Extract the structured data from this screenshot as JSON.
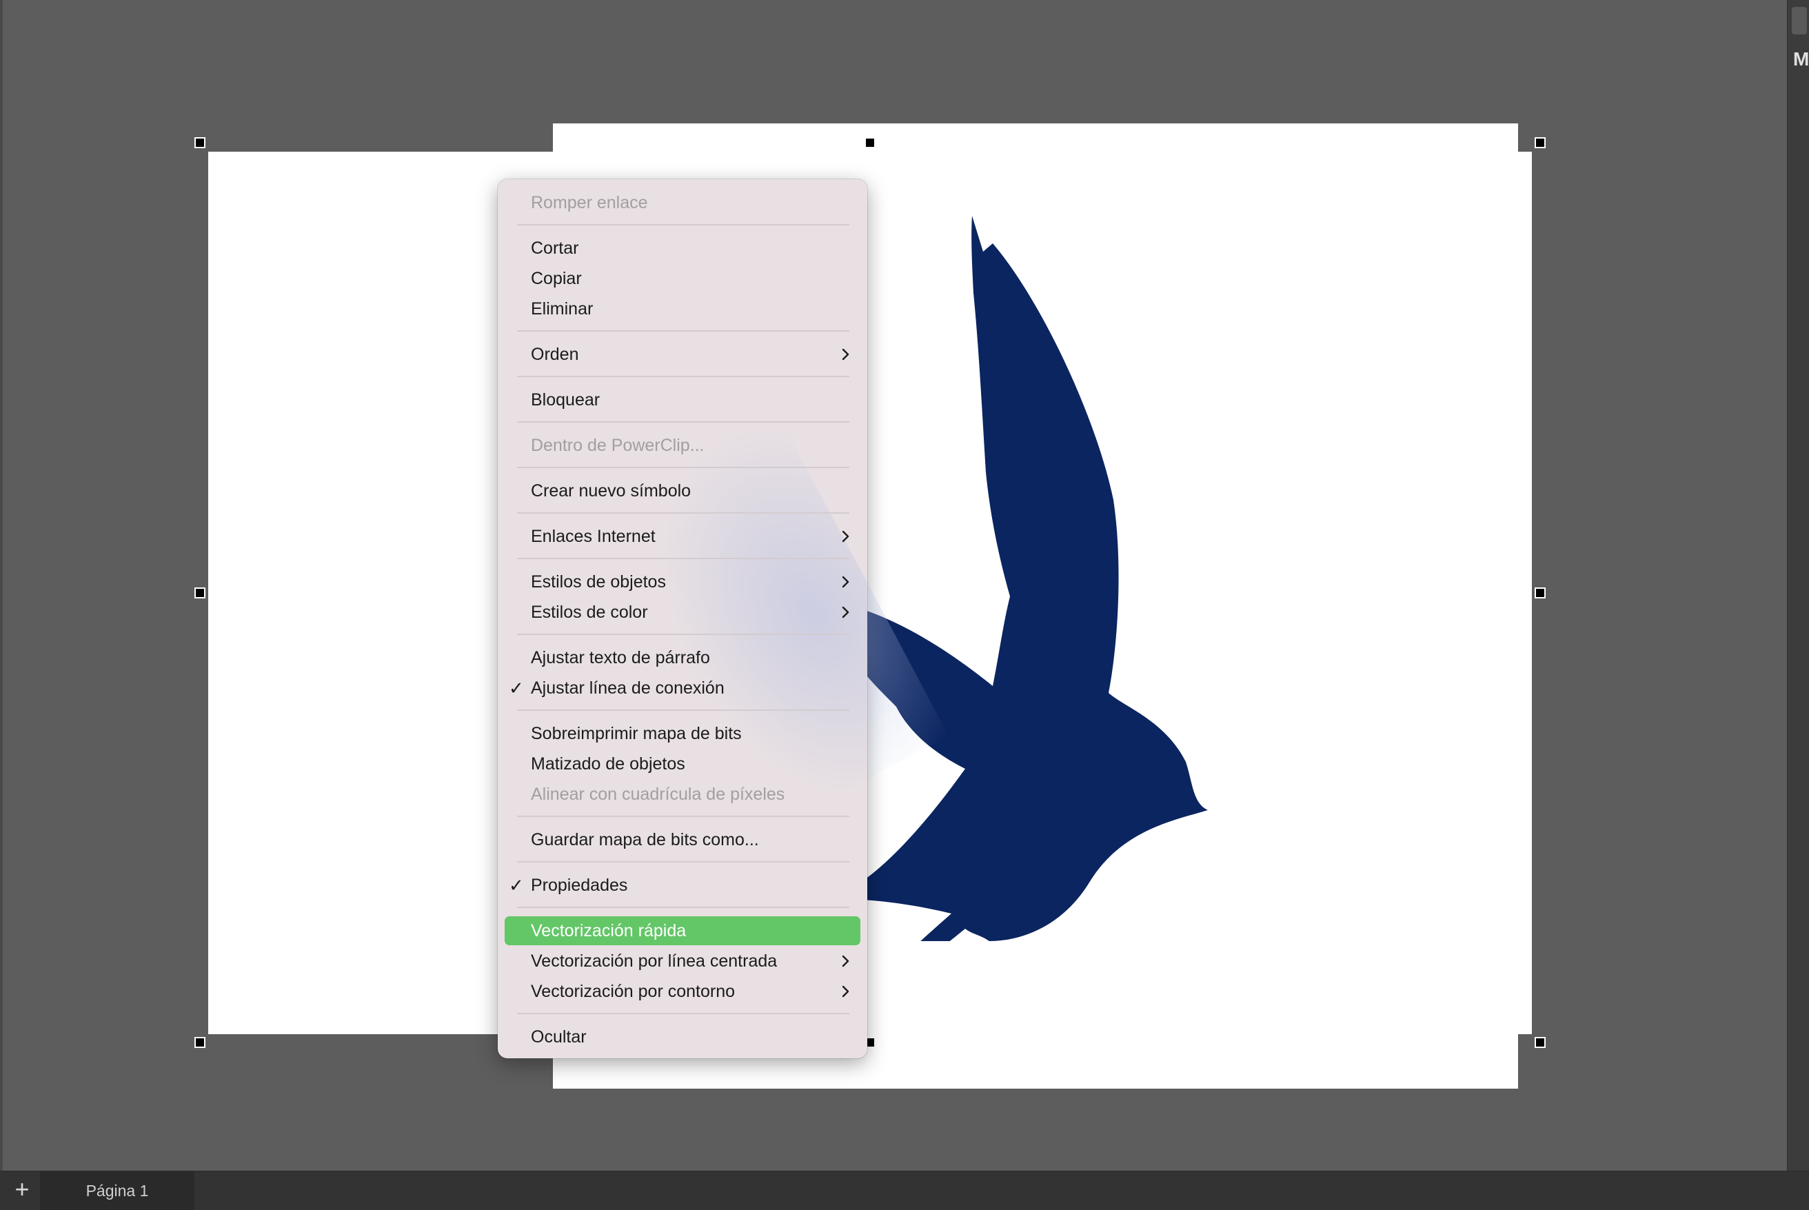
{
  "context_menu": {
    "items": [
      {
        "label": "Romper enlace"
      },
      {
        "label": "Cortar"
      },
      {
        "label": "Copiar"
      },
      {
        "label": "Eliminar"
      },
      {
        "label": "Orden"
      },
      {
        "label": "Bloquear"
      },
      {
        "label": "Dentro de PowerClip..."
      },
      {
        "label": "Crear nuevo símbolo"
      },
      {
        "label": "Enlaces Internet"
      },
      {
        "label": "Estilos de objetos"
      },
      {
        "label": "Estilos de color"
      },
      {
        "label": "Ajustar texto de párrafo"
      },
      {
        "label": "Ajustar línea de conexión"
      },
      {
        "label": "Sobreimprimir mapa de bits"
      },
      {
        "label": "Matizado de objetos"
      },
      {
        "label": "Alinear con cuadrícula de píxeles"
      },
      {
        "label": "Guardar mapa de bits como..."
      },
      {
        "label": "Propiedades"
      },
      {
        "label": "Vectorización rápida"
      },
      {
        "label": "Vectorización por línea centrada"
      },
      {
        "label": "Vectorización por contorno"
      },
      {
        "label": "Ocultar"
      }
    ],
    "check_glyph": "✓",
    "highlight_color": "#63c667"
  },
  "canvas": {
    "bitmap_fill_color": "#0b2560",
    "icons": [
      "bird-silhouette"
    ]
  },
  "bottom_bar": {
    "add_page_glyph": "+",
    "page_tab_label": "Página 1"
  },
  "right_panel": {
    "letter": "M"
  }
}
